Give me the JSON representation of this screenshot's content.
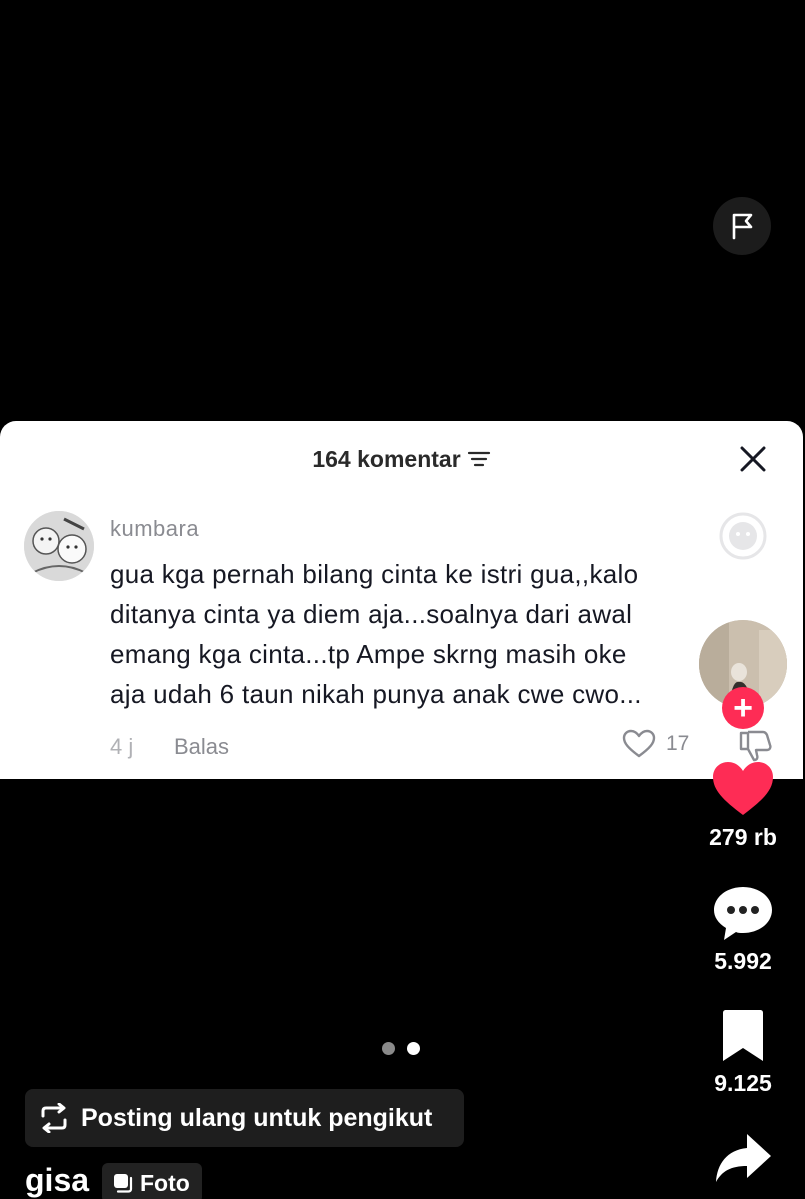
{
  "comments_panel": {
    "count_label": "164 komentar",
    "comment": {
      "username": "kumbara",
      "text_lines": [
        "gua kga pernah bilang cinta ke istri gua,,kalo",
        "ditanya cinta ya diem aja...soalnya dari awal",
        "emang kga cinta...tp Ampe skrng masih oke",
        "aja udah 6 taun nikah punya anak cwe cwo..."
      ],
      "age": "4 j",
      "reply_label": "Balas",
      "like_count": "17"
    }
  },
  "actions": {
    "follow_symbol": "+",
    "likes": "279 rb",
    "comments": "5.992",
    "saves": "9.125"
  },
  "carousel": {
    "total": 2,
    "active_index": 1
  },
  "repost": {
    "label": "Posting ulang untuk pengikut"
  },
  "author": {
    "name": "gisa",
    "type_label": "Foto"
  },
  "colors": {
    "accent": "#fe2c55",
    "background": "#000000",
    "card": "#ffffff",
    "muted_text": "#8a8b91"
  },
  "icons": {
    "report": "flag-icon",
    "filter": "filter-lines-icon",
    "close": "close-icon",
    "emoji": "emoji-icon",
    "like_comment": "heart-outline-icon",
    "dislike": "thumbs-down-icon",
    "like": "heart-icon",
    "comments": "chat-bubble-icon",
    "save": "bookmark-icon",
    "share": "share-arrow-icon",
    "repost": "repost-icon",
    "photo": "photo-stack-icon"
  }
}
